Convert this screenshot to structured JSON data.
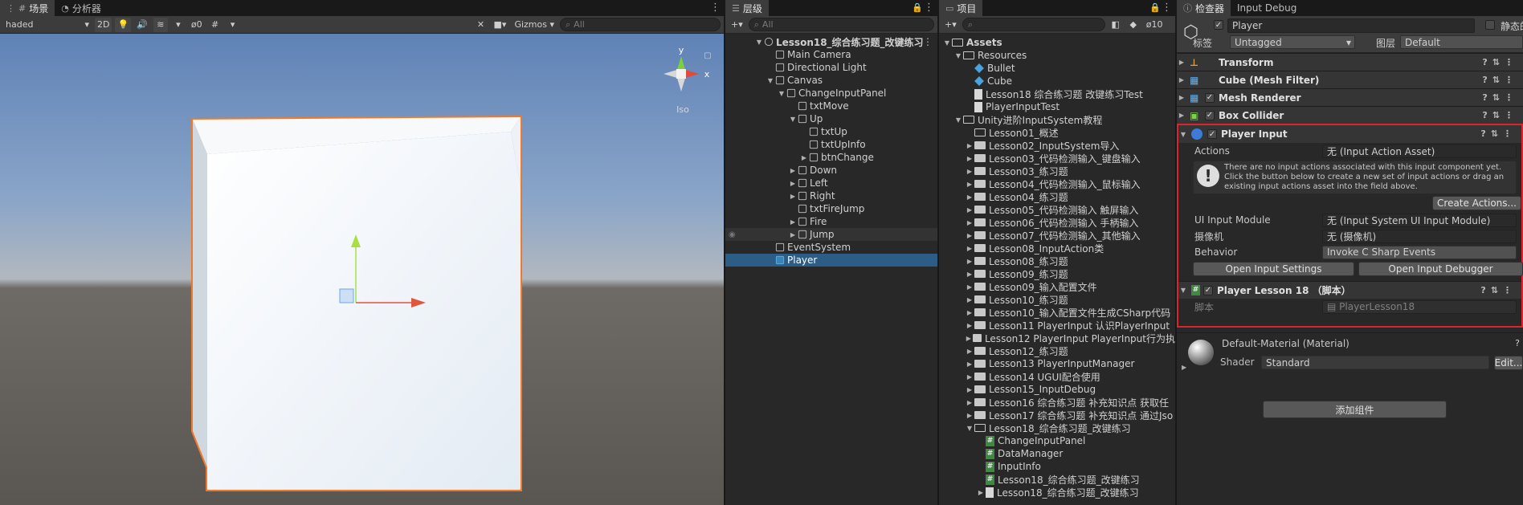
{
  "scene": {
    "tabs": [
      {
        "label": "场景"
      },
      {
        "label": "分析器"
      }
    ],
    "shading": "haded",
    "toggle_2d": "2D",
    "hidden_count": "0",
    "gizmos": "Gizmos",
    "search_placeholder": "All",
    "orientation": {
      "x": "x",
      "y": "y",
      "mode": "Iso"
    }
  },
  "hierarchy": {
    "tab": "层级",
    "search_placeholder": "All",
    "items": [
      {
        "label": "Lesson18_综合练习题_改键练习",
        "depth": 0,
        "expand": "▼",
        "icon": "scene",
        "bold": true
      },
      {
        "label": "Main Camera",
        "depth": 1,
        "expand": "",
        "icon": "cube"
      },
      {
        "label": "Directional Light",
        "depth": 1,
        "expand": "",
        "icon": "cube"
      },
      {
        "label": "Canvas",
        "depth": 1,
        "expand": "▼",
        "icon": "cube"
      },
      {
        "label": "ChangeInputPanel",
        "depth": 2,
        "expand": "▼",
        "icon": "cube"
      },
      {
        "label": "txtMove",
        "depth": 3,
        "expand": "",
        "icon": "cube"
      },
      {
        "label": "Up",
        "depth": 3,
        "expand": "▼",
        "icon": "cube"
      },
      {
        "label": "txtUp",
        "depth": 4,
        "expand": "",
        "icon": "cube"
      },
      {
        "label": "txtUpInfo",
        "depth": 4,
        "expand": "",
        "icon": "cube"
      },
      {
        "label": "btnChange",
        "depth": 4,
        "expand": "▶",
        "icon": "cube"
      },
      {
        "label": "Down",
        "depth": 3,
        "expand": "▶",
        "icon": "cube"
      },
      {
        "label": "Left",
        "depth": 3,
        "expand": "▶",
        "icon": "cube"
      },
      {
        "label": "Right",
        "depth": 3,
        "expand": "▶",
        "icon": "cube"
      },
      {
        "label": "txtFireJump",
        "depth": 3,
        "expand": "",
        "icon": "cube"
      },
      {
        "label": "Fire",
        "depth": 3,
        "expand": "▶",
        "icon": "cube"
      },
      {
        "label": "Jump",
        "depth": 3,
        "expand": "▶",
        "icon": "cube",
        "hover": true
      },
      {
        "label": "EventSystem",
        "depth": 1,
        "expand": "",
        "icon": "cube"
      },
      {
        "label": "Player",
        "depth": 1,
        "expand": "",
        "icon": "cube-blue",
        "selected": true
      }
    ]
  },
  "project": {
    "tab": "项目",
    "badge_count": "10",
    "items": [
      {
        "label": "Assets",
        "depth": 0,
        "expand": "▼",
        "icon": "folder-open",
        "bold": true
      },
      {
        "label": "Resources",
        "depth": 1,
        "expand": "▼",
        "icon": "folder-open"
      },
      {
        "label": "Bullet",
        "depth": 2,
        "expand": "",
        "icon": "prefab"
      },
      {
        "label": "Cube",
        "depth": 2,
        "expand": "",
        "icon": "prefab"
      },
      {
        "label": "Lesson18 综合练习题 改键练习Test",
        "depth": 2,
        "expand": "",
        "icon": "doc"
      },
      {
        "label": "PlayerInputTest",
        "depth": 2,
        "expand": "",
        "icon": "doc"
      },
      {
        "label": "Unity进阶InputSystem教程",
        "depth": 1,
        "expand": "▼",
        "icon": "folder-open"
      },
      {
        "label": "Lesson01_概述",
        "depth": 2,
        "expand": "",
        "icon": "folder-open"
      },
      {
        "label": "Lesson02_InputSystem导入",
        "depth": 2,
        "expand": "▶",
        "icon": "folder"
      },
      {
        "label": "Lesson03_代码检测输入_键盘输入",
        "depth": 2,
        "expand": "▶",
        "icon": "folder"
      },
      {
        "label": "Lesson03_练习题",
        "depth": 2,
        "expand": "▶",
        "icon": "folder"
      },
      {
        "label": "Lesson04_代码检测输入_鼠标输入",
        "depth": 2,
        "expand": "▶",
        "icon": "folder"
      },
      {
        "label": "Lesson04_练习题",
        "depth": 2,
        "expand": "▶",
        "icon": "folder"
      },
      {
        "label": "Lesson05_代码检测输入 触屏输入",
        "depth": 2,
        "expand": "▶",
        "icon": "folder"
      },
      {
        "label": "Lesson06_代码检测输入 手柄输入",
        "depth": 2,
        "expand": "▶",
        "icon": "folder"
      },
      {
        "label": "Lesson07_代码检测输入_其他输入",
        "depth": 2,
        "expand": "▶",
        "icon": "folder"
      },
      {
        "label": "Lesson08_InputAction类",
        "depth": 2,
        "expand": "▶",
        "icon": "folder"
      },
      {
        "label": "Lesson08_练习题",
        "depth": 2,
        "expand": "▶",
        "icon": "folder"
      },
      {
        "label": "Lesson09_练习题",
        "depth": 2,
        "expand": "▶",
        "icon": "folder"
      },
      {
        "label": "Lesson09_输入配置文件",
        "depth": 2,
        "expand": "▶",
        "icon": "folder"
      },
      {
        "label": "Lesson10_练习题",
        "depth": 2,
        "expand": "▶",
        "icon": "folder"
      },
      {
        "label": "Lesson10_输入配置文件生成CSharp代码",
        "depth": 2,
        "expand": "▶",
        "icon": "folder"
      },
      {
        "label": "Lesson11 PlayerInput 认识PlayerInput",
        "depth": 2,
        "expand": "▶",
        "icon": "folder"
      },
      {
        "label": "Lesson12 PlayerInput PlayerInput行为执",
        "depth": 2,
        "expand": "▶",
        "icon": "folder"
      },
      {
        "label": "Lesson12_练习题",
        "depth": 2,
        "expand": "▶",
        "icon": "folder"
      },
      {
        "label": "Lesson13 PlayerInputManager",
        "depth": 2,
        "expand": "▶",
        "icon": "folder"
      },
      {
        "label": "Lesson14 UGUI配合使用",
        "depth": 2,
        "expand": "▶",
        "icon": "folder"
      },
      {
        "label": "Lesson15_InputDebug",
        "depth": 2,
        "expand": "▶",
        "icon": "folder"
      },
      {
        "label": "Lesson16 综合练习题 补充知识点 获取任",
        "depth": 2,
        "expand": "▶",
        "icon": "folder"
      },
      {
        "label": "Lesson17 综合练习题 补充知识点 通过Jso",
        "depth": 2,
        "expand": "▶",
        "icon": "folder"
      },
      {
        "label": "Lesson18_综合练习题_改键练习",
        "depth": 2,
        "expand": "▼",
        "icon": "folder-open"
      },
      {
        "label": "ChangeInputPanel",
        "depth": 3,
        "expand": "",
        "icon": "script"
      },
      {
        "label": "DataManager",
        "depth": 3,
        "expand": "",
        "icon": "script"
      },
      {
        "label": "InputInfo",
        "depth": 3,
        "expand": "",
        "icon": "script"
      },
      {
        "label": "Lesson18_综合练习题_改键练习",
        "depth": 3,
        "expand": "",
        "icon": "script"
      },
      {
        "label": "Lesson18_综合练习题_改键练习",
        "depth": 3,
        "expand": "▶",
        "icon": "doc"
      }
    ]
  },
  "inspector": {
    "tabs": [
      {
        "label": "检查器"
      },
      {
        "label": "Input Debug"
      }
    ],
    "object_name": "Player",
    "static_label": "静态的",
    "tag_label": "标签",
    "tag_value": "Untagged",
    "layer_label": "图层",
    "layer_value": "Default",
    "components": [
      {
        "name": "Transform",
        "checkbox": false
      },
      {
        "name": "Cube (Mesh Filter)",
        "checkbox": false
      },
      {
        "name": "Mesh Renderer",
        "checkbox": true
      },
      {
        "name": "Box Collider",
        "checkbox": true
      }
    ],
    "player_input": {
      "title": "Player Input",
      "actions_label": "Actions",
      "actions_value": "无 (Input Action Asset)",
      "warning": "There are no input actions associated with this input component yet. Click the button below to create a new set of input actions or drag an existing input actions asset into the field above.",
      "create_actions": "Create Actions...",
      "ui_module_label": "UI Input Module",
      "ui_module_value": "无 (Input System UI Input Module)",
      "camera_label": "摄像机",
      "camera_value": "无 (摄像机)",
      "behavior_label": "Behavior",
      "behavior_value": "Invoke C Sharp Events",
      "open_settings": "Open Input Settings",
      "open_debugger": "Open Input Debugger"
    },
    "player_lesson": {
      "title": "Player Lesson 18 （脚本）",
      "script_label": "脚本",
      "script_value": "PlayerLesson18"
    },
    "material": {
      "name": "Default-Material (Material)",
      "shader_label": "Shader",
      "shader_value": "Standard",
      "edit": "Edit..."
    },
    "add_component": "添加组件"
  },
  "colors": {
    "selection": "#2c5d87",
    "highlight_border": "#d9252b",
    "outline": "#f07a2a"
  }
}
